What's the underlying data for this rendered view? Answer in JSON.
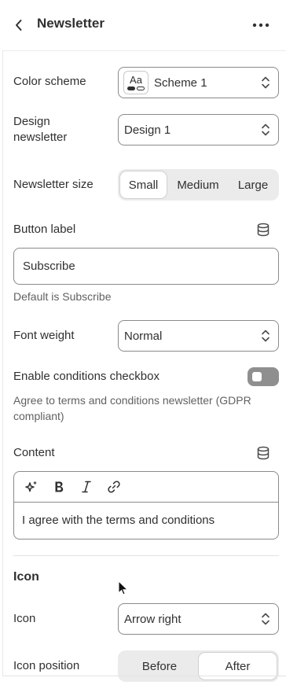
{
  "header": {
    "title": "Newsletter"
  },
  "fields": {
    "color_scheme": {
      "label": "Color scheme",
      "value": "Scheme 1",
      "swatch_text": "Aa"
    },
    "design": {
      "label": "Design newsletter",
      "value": "Design 1"
    },
    "size": {
      "label": "Newsletter size",
      "options": [
        "Small",
        "Medium",
        "Large"
      ],
      "selected": "Small"
    },
    "button_label": {
      "label": "Button label",
      "value": "Subscribe",
      "help": "Default is Subscribe"
    },
    "font_weight": {
      "label": "Font weight",
      "value": "Normal"
    },
    "conditions": {
      "label": "Enable conditions checkbox",
      "help": "Agree to terms and conditions newsletter (GDPR compliant)",
      "enabled": false
    },
    "content": {
      "label": "Content",
      "value": "I agree with the terms and conditions"
    }
  },
  "icon_section": {
    "title": "Icon",
    "icon": {
      "label": "Icon",
      "value": "Arrow right"
    },
    "position": {
      "label": "Icon position",
      "options": [
        "Before",
        "After"
      ],
      "selected": "After"
    }
  }
}
